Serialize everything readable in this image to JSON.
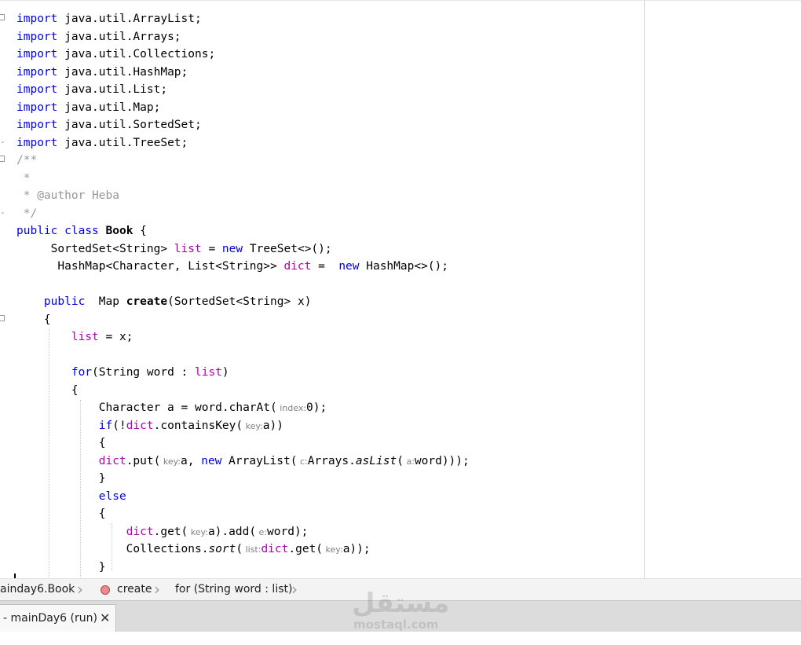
{
  "editor": {
    "lines": [
      {
        "segs": [
          {
            "t": "import",
            "c": "kw"
          },
          {
            "t": " java.util.ArrayList;"
          }
        ]
      },
      {
        "segs": [
          {
            "t": "import",
            "c": "kw"
          },
          {
            "t": " java.util.Arrays;"
          }
        ]
      },
      {
        "segs": [
          {
            "t": "import",
            "c": "kw"
          },
          {
            "t": " java.util.Collections;"
          }
        ]
      },
      {
        "segs": [
          {
            "t": "import",
            "c": "kw"
          },
          {
            "t": " java.util.HashMap;"
          }
        ]
      },
      {
        "segs": [
          {
            "t": "import",
            "c": "kw"
          },
          {
            "t": " java.util.List;"
          }
        ]
      },
      {
        "segs": [
          {
            "t": "import",
            "c": "kw"
          },
          {
            "t": " java.util.Map;"
          }
        ]
      },
      {
        "segs": [
          {
            "t": "import",
            "c": "kw"
          },
          {
            "t": " java.util.SortedSet;"
          }
        ]
      },
      {
        "segs": [
          {
            "t": "import",
            "c": "kw"
          },
          {
            "t": " java.util.TreeSet;"
          }
        ]
      },
      {
        "segs": [
          {
            "t": "/**",
            "c": "cm"
          }
        ]
      },
      {
        "segs": [
          {
            "t": " *",
            "c": "cm"
          }
        ]
      },
      {
        "segs": [
          {
            "t": " * @author Heba",
            "c": "cm"
          }
        ]
      },
      {
        "segs": [
          {
            "t": " */",
            "c": "cm"
          }
        ]
      },
      {
        "segs": [
          {
            "t": "public",
            "c": "kw"
          },
          {
            "t": " "
          },
          {
            "t": "class",
            "c": "kw"
          },
          {
            "t": " "
          },
          {
            "t": "Book",
            "c": "bold"
          },
          {
            "t": " {"
          }
        ]
      },
      {
        "segs": [
          {
            "t": "     SortedSet<String> "
          },
          {
            "t": "list",
            "c": "fld"
          },
          {
            "t": " = "
          },
          {
            "t": "new",
            "c": "kw"
          },
          {
            "t": " TreeSet<>();"
          }
        ]
      },
      {
        "segs": [
          {
            "t": "      HashMap<Character, List<String>> "
          },
          {
            "t": "dict",
            "c": "fld"
          },
          {
            "t": " =  "
          },
          {
            "t": "new",
            "c": "kw"
          },
          {
            "t": " HashMap<>();"
          }
        ]
      },
      {
        "segs": []
      },
      {
        "segs": [
          {
            "t": "    "
          },
          {
            "t": "public",
            "c": "kw"
          },
          {
            "t": "  Map "
          },
          {
            "t": "create",
            "c": "bold"
          },
          {
            "t": "(SortedSet<String> x)"
          }
        ]
      },
      {
        "segs": [
          {
            "t": "    {"
          }
        ]
      },
      {
        "segs": [
          {
            "t": "        "
          },
          {
            "t": "list",
            "c": "fld"
          },
          {
            "t": " = x;"
          }
        ]
      },
      {
        "segs": []
      },
      {
        "segs": [
          {
            "t": "        "
          },
          {
            "t": "for",
            "c": "kw"
          },
          {
            "t": "(String word : "
          },
          {
            "t": "list",
            "c": "fld"
          },
          {
            "t": ")"
          }
        ]
      },
      {
        "segs": [
          {
            "t": "        {"
          }
        ]
      },
      {
        "segs": [
          {
            "t": "            Character a = word.charAt("
          },
          {
            "h": "index:"
          },
          {
            "t": "0);"
          }
        ]
      },
      {
        "segs": [
          {
            "t": "            "
          },
          {
            "t": "if",
            "c": "kw"
          },
          {
            "t": "(!"
          },
          {
            "t": "dict",
            "c": "fld"
          },
          {
            "t": ".containsKey("
          },
          {
            "h": "key:"
          },
          {
            "t": "a))"
          }
        ]
      },
      {
        "segs": [
          {
            "t": "            {"
          }
        ]
      },
      {
        "segs": [
          {
            "t": "            "
          },
          {
            "t": "dict",
            "c": "fld"
          },
          {
            "t": ".put("
          },
          {
            "h": "key:"
          },
          {
            "t": "a, "
          },
          {
            "t": "new",
            "c": "kw"
          },
          {
            "t": " ArrayList("
          },
          {
            "h": "c:"
          },
          {
            "t": "Arrays."
          },
          {
            "t": "asList",
            "c": "it"
          },
          {
            "t": "("
          },
          {
            "h": "a:"
          },
          {
            "t": "word)));"
          }
        ]
      },
      {
        "segs": [
          {
            "t": "            }"
          }
        ]
      },
      {
        "segs": [
          {
            "t": "            "
          },
          {
            "t": "else",
            "c": "kw"
          }
        ]
      },
      {
        "segs": [
          {
            "t": "            {"
          }
        ]
      },
      {
        "segs": [
          {
            "t": "                "
          },
          {
            "t": "dict",
            "c": "fld"
          },
          {
            "t": ".get("
          },
          {
            "h": "key:"
          },
          {
            "t": "a).add("
          },
          {
            "h": "e:"
          },
          {
            "t": "word);"
          }
        ]
      },
      {
        "segs": [
          {
            "t": "                Collections."
          },
          {
            "t": "sort",
            "c": "it"
          },
          {
            "t": "("
          },
          {
            "h": "list:"
          },
          {
            "t": "dict",
            "c": "fld"
          },
          {
            "t": ".get("
          },
          {
            "h": "key:"
          },
          {
            "t": "a));"
          }
        ]
      },
      {
        "segs": [
          {
            "t": "            }"
          }
        ]
      }
    ]
  },
  "breadcrumb": {
    "items": [
      "ainday6.Book",
      "create",
      "for (String word : list)"
    ]
  },
  "output": {
    "tab_label": "- mainDay6 (run)",
    "close_glyph": "✕"
  },
  "watermark": {
    "arabic": "مستقل",
    "latin": "mostaql.com"
  }
}
